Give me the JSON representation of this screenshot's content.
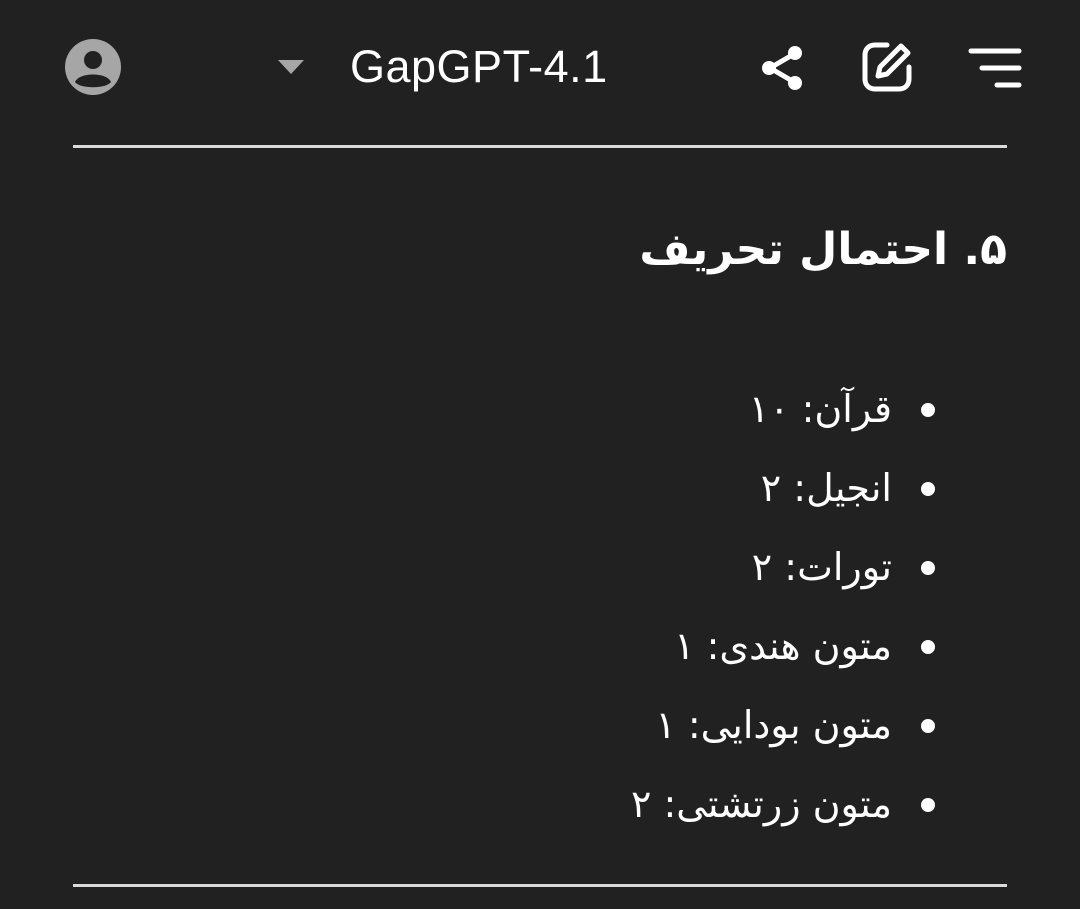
{
  "header": {
    "title": "GapGPT-4.1",
    "avatar_icon": "account-circle-icon",
    "dropdown_icon": "caret-down-icon",
    "share_icon": "share-icon",
    "edit_icon": "new-chat-edit-icon",
    "menu_icon": "menu-icon"
  },
  "section": {
    "heading": "۵. احتمال تحریف",
    "items": [
      "قرآن: ۱۰",
      "انجیل: ۲",
      "تورات: ۲",
      "متون هندی: ۱",
      "متون بودایی: ۱",
      "متون زرتشتی: ۲"
    ]
  },
  "colors": {
    "background": "#212121",
    "text": "#ffffff",
    "divider": "#d9d9d9",
    "icon_muted": "#a6a6a6"
  }
}
